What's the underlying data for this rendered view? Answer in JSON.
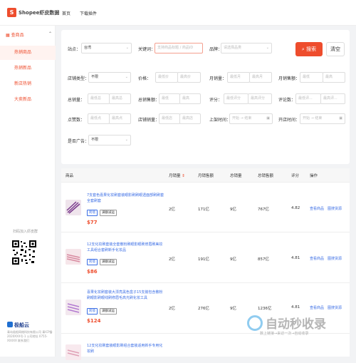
{
  "header": {
    "brand": "Shopee虾皮数据",
    "nav": [
      "首页",
      "下载插件"
    ]
  },
  "sidebar": {
    "section": "查商品",
    "items": [
      "热销商品",
      "热销新品",
      "新店热销",
      "大卖新品"
    ],
    "qr_label": "扫码加入虾皮群",
    "company_name": "极船云",
    "company_info": "青岛极船网络科技有限公司 青ICP备2020XXX号-1 公司地址 0755-XXXXX 联系我们"
  },
  "filters": {
    "site_label": "站点：",
    "site_value": "台湾",
    "keyword_label": "关键词：",
    "keyword_placeholder": "支持商品标题 / 商品ID",
    "brand_label": "品牌：",
    "brand_placeholder": "请选择品类",
    "search_btn": "搜索",
    "clear_btn": "清空",
    "shop_type_label": "店铺类型：",
    "shop_type_value": "不限",
    "price_label": "价格：",
    "monthly_sales_label": "月销量：",
    "monthly_gmv_label": "月销售额：",
    "total_sales_label": "总销量：",
    "total_gmv_label": "总销售额：",
    "rating_label": "评分：",
    "reviews_label": "评论数：",
    "likes_label": "点赞数：",
    "shop_sales_label": "店铺销量：",
    "listed_time_label": "上架时间：",
    "shop_time_label": "开店时间：",
    "ad_label": "是否广告：",
    "ad_value": "不限",
    "min_ph": "最低价",
    "max_ph": "最高价",
    "min_short": "最低",
    "max_short": "最高",
    "min_sales": "最低月",
    "max_sales": "最高月",
    "min_sold": "最低总",
    "max_sold": "最高总",
    "min_rate": "最低评分",
    "max_rate": "最高评分",
    "min_rev": "最低评...",
    "max_rev": "最高评...",
    "min_like": "最低点",
    "max_like": "最高点",
    "min_shop": "最低店",
    "max_shop": "最高店",
    "start_date": "开始",
    "end_date": "结束",
    "tilde": "~"
  },
  "table": {
    "headers": [
      "商品",
      "月销量",
      "月销售额",
      "总销量",
      "总销售额",
      "评分",
      "操作"
    ],
    "rows": [
      {
        "name": "7支套色嘉果化妆刷套装眼影刷刷眼透面部刷刷套全套刷套",
        "tag1": "跨境",
        "tag2": "满额减运",
        "price": "$77",
        "monthly_sales": "2亿",
        "monthly_gmv": "171亿",
        "total_sales": "9亿",
        "total_gmv": "767亿",
        "rating": "4.82",
        "op1": "查看商品",
        "op2": "图搜货源"
      },
      {
        "name": "12支化妆刷套装全套散粉刷眼影眼刷修眉刷美妆工具组合套刷新手化妆品",
        "tag1": "跨境",
        "tag2": "满额减运",
        "price": "$86",
        "monthly_sales": "2亿",
        "monthly_gmv": "191亿",
        "total_sales": "9亿",
        "total_gmv": "857亿",
        "rating": "4.81",
        "op1": "查看商品",
        "op2": "图搜货源"
      },
      {
        "name": "喜果化妆刷套装大漂亮黑色盒子15支装包含散粉刷眼影刷眼线刷修眉毛高光刷化妆工具",
        "tag1": "跨境",
        "tag2": "满额减运",
        "price": "$124",
        "monthly_sales": "2亿",
        "monthly_gmv": "276亿",
        "total_sales": "9亿",
        "total_gmv": "1236亿",
        "rating": "4.81",
        "op1": "查看商品",
        "op2": "图搜货源"
      },
      {
        "name": "12支化妆刷套装眼影刷组合套装适用新手专用化妆刷",
        "tag1": "",
        "tag2": "",
        "price": "",
        "monthly_sales": "",
        "monthly_gmv": "",
        "total_sales": "",
        "total_gmv": "",
        "rating": "",
        "op1": "",
        "op2": ""
      }
    ]
  },
  "watermark": {
    "big": "自动秒收录",
    "small": "数上链接→来访一次→自动收录"
  },
  "colors": {
    "accent": "#ee4d2d",
    "link": "#3b6ee5"
  }
}
